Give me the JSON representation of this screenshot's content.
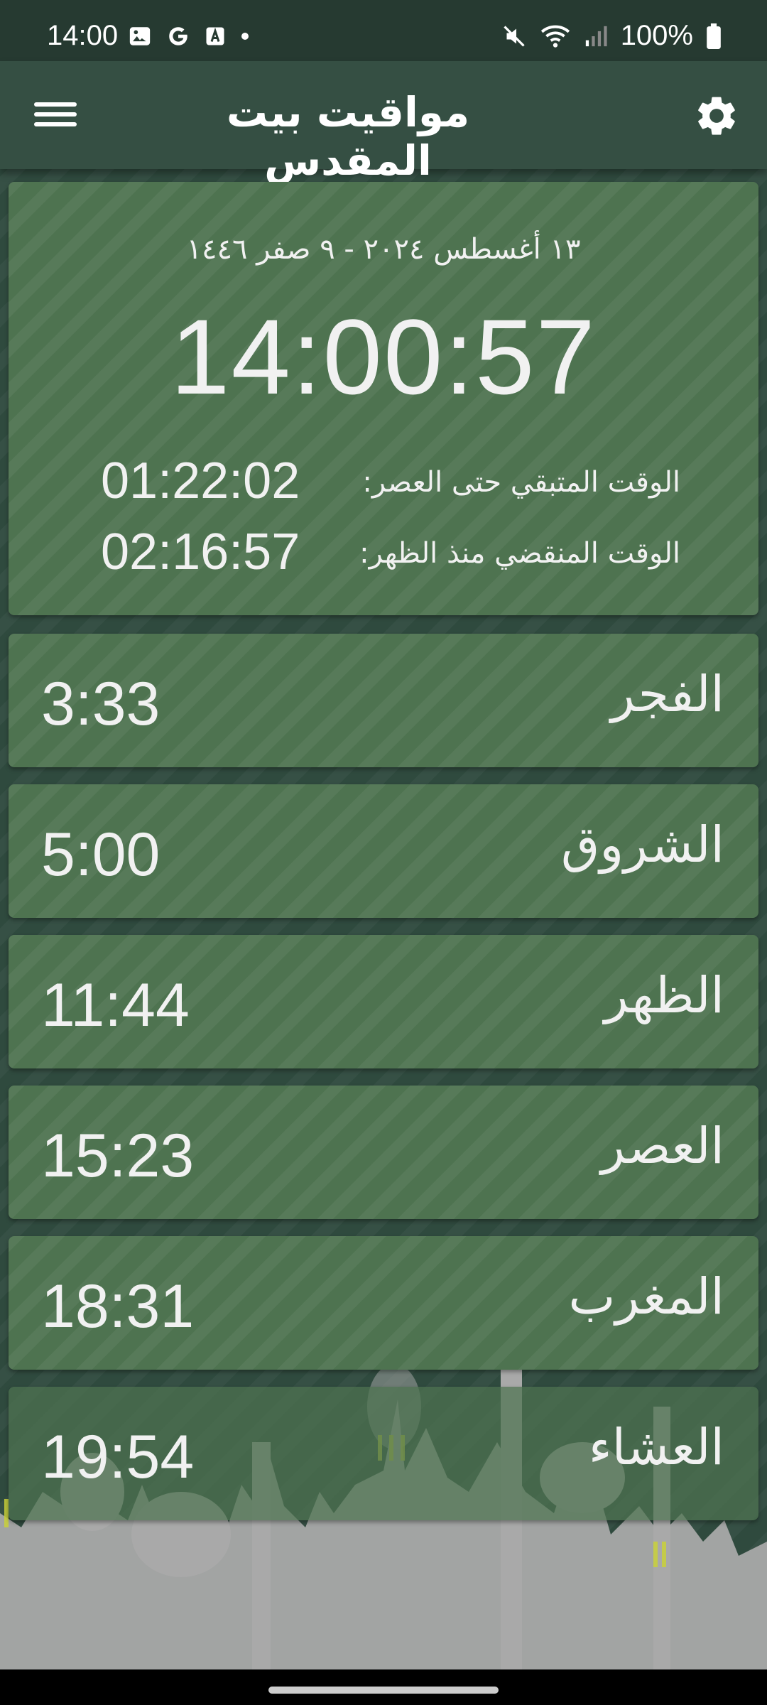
{
  "status": {
    "time": "14:00",
    "battery": "100%"
  },
  "app": {
    "title": "مواقيت بيت المقدس"
  },
  "today": {
    "date": "١٣ أغسطس ٢٠٢٤  -  ٩ صفر ١٤٤٦",
    "clock": "14:00:57",
    "remaining_label": "الوقت المتبقي حتى العصر:",
    "remaining_value": "01:22:02",
    "elapsed_label": "الوقت المنقضي منذ الظهر:",
    "elapsed_value": "02:16:57"
  },
  "prayers": [
    {
      "name": "الفجر",
      "time": "3:33"
    },
    {
      "name": "الشروق",
      "time": "5:00"
    },
    {
      "name": "الظهر",
      "time": "11:44"
    },
    {
      "name": "العصر",
      "time": "15:23"
    },
    {
      "name": "المغرب",
      "time": "18:31"
    },
    {
      "name": "العشاء",
      "time": "19:54"
    }
  ],
  "colors": {
    "background": "#2f4a3e",
    "appbar": "#354f43",
    "card": "#4e7350",
    "skyline": "#a9a9a9"
  }
}
